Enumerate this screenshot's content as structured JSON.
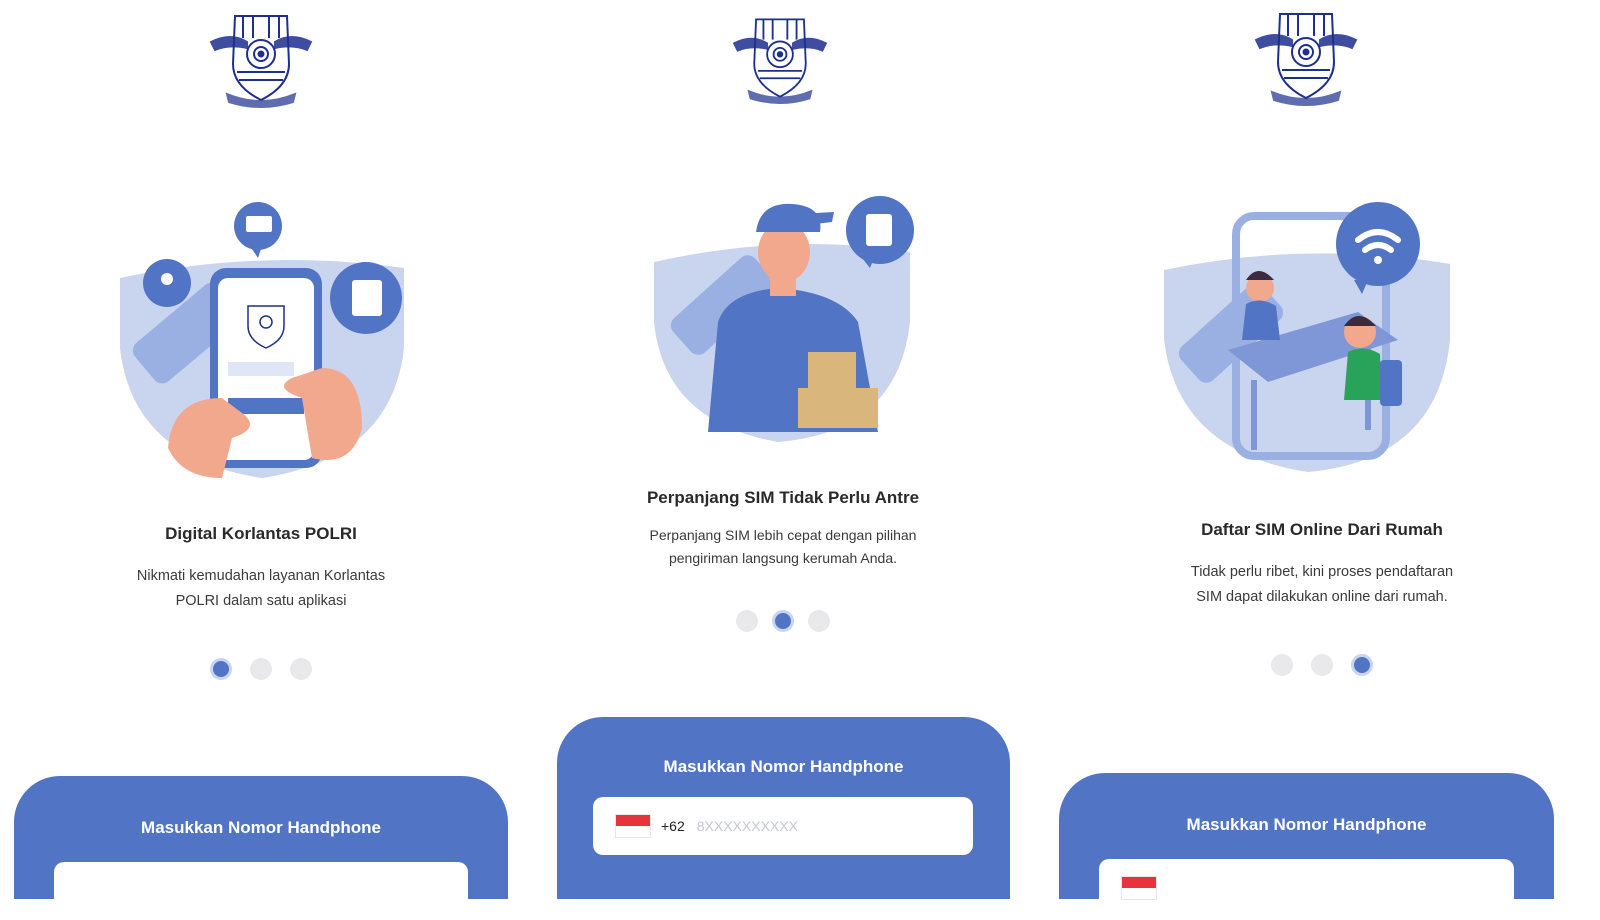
{
  "screens": [
    {
      "title": "Digital Korlantas POLRI",
      "description_line1": "Nikmati kemudahan layanan Korlantas",
      "description_line2": "POLRI dalam satu aplikasi",
      "active_dot": 0,
      "panel": {
        "title": "Masukkan Nomor Handphone"
      }
    },
    {
      "title": "Perpanjang SIM Tidak Perlu Antre",
      "description_line1": "Perpanjang SIM lebih cepat dengan pilihan",
      "description_line2": "pengiriman langsung kerumah Anda.",
      "active_dot": 1,
      "panel": {
        "title": "Masukkan Nomor Handphone",
        "country_code": "+62",
        "placeholder": "8XXXXXXXXXX"
      }
    },
    {
      "title": "Daftar SIM Online Dari Rumah",
      "description_line1": "Tidak perlu ribet, kini proses pendaftaran",
      "description_line2": "SIM dapat dilakukan online dari rumah.",
      "active_dot": 2,
      "panel": {
        "title": "Masukkan Nomor Handphone"
      }
    }
  ],
  "colors": {
    "primary": "#5174c4",
    "light_blue": "#c9d4ef",
    "dot_inactive": "#e9e9ec",
    "flag_red": "#e8323c",
    "logo": "#1d2f8f"
  },
  "icons": [
    "korlantas-logo-icon",
    "id-card-icon",
    "location-icon",
    "document-icon",
    "wifi-icon",
    "indonesia-flag-icon"
  ]
}
